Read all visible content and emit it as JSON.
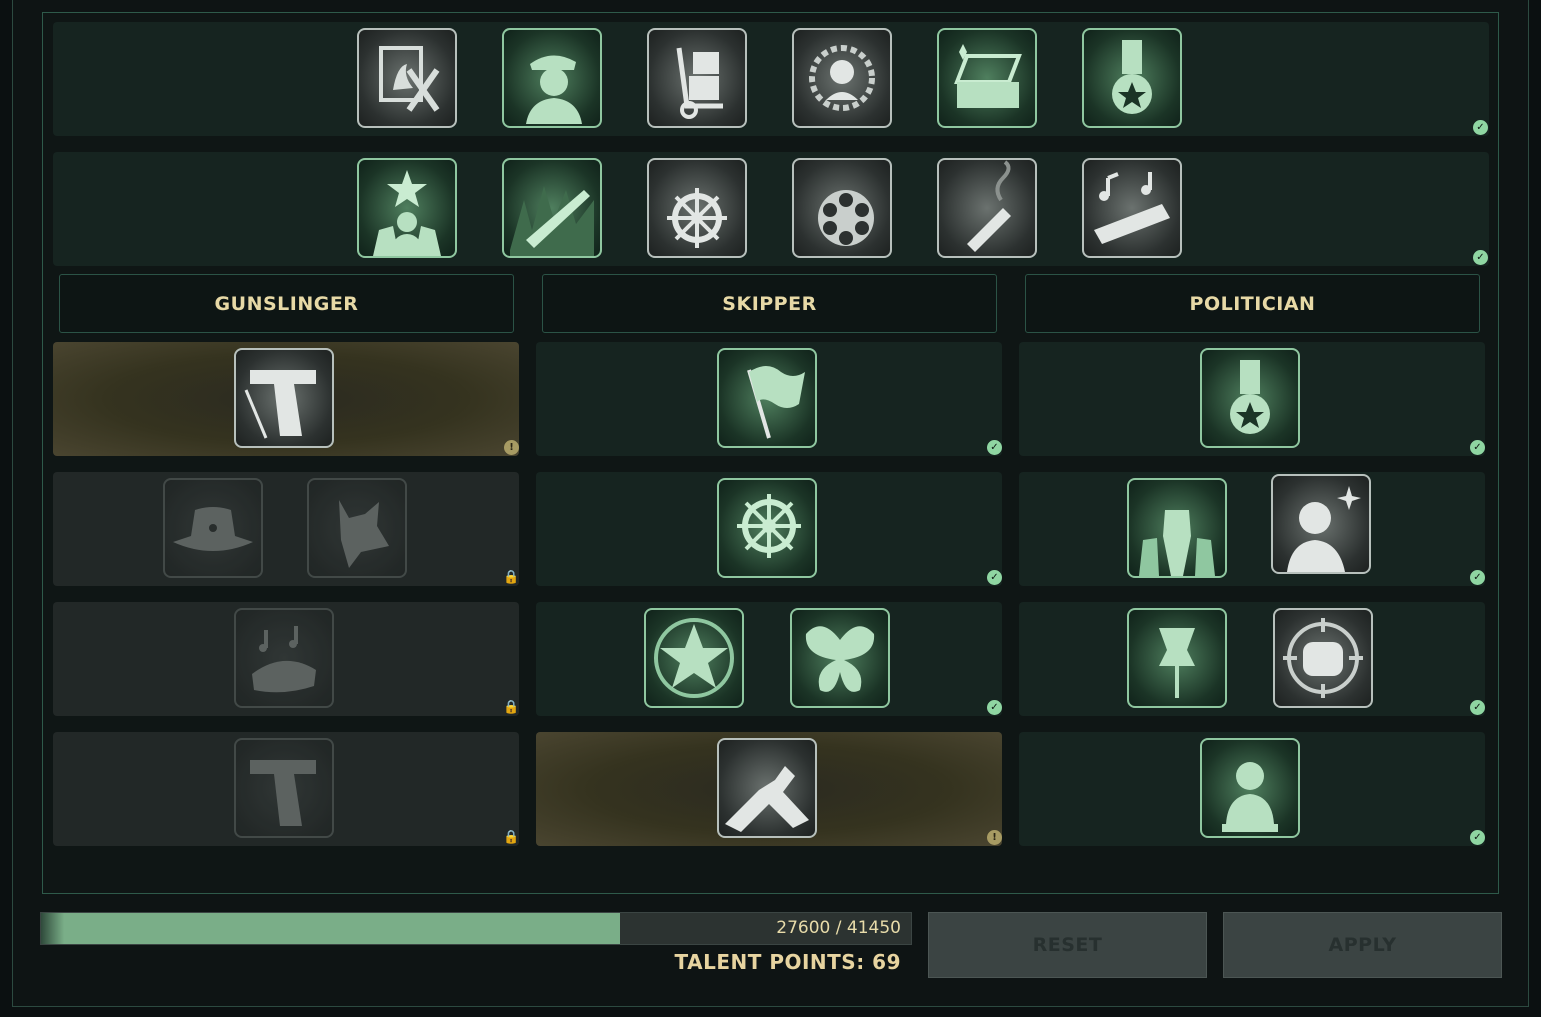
{
  "top_rows": {
    "row1": {
      "icons": [
        "crossed-portrait-icon",
        "officer-icon",
        "hand-truck-icon",
        "laurel-portrait-icon",
        "open-case-icon",
        "medal-icon"
      ]
    },
    "row2": {
      "icons": [
        "star-crowd-icon",
        "burning-rifle-icon",
        "ships-wheel-icon",
        "revolver-cylinder-icon",
        "cigar-icon",
        "harmonica-icon"
      ]
    }
  },
  "classes": [
    {
      "title": "GUNSLINGER"
    },
    {
      "title": "SKIPPER"
    },
    {
      "title": "POLITICIAN"
    }
  ],
  "progress": {
    "current": 27600,
    "max": 41450,
    "label": "27600 / 41450"
  },
  "talent_points": "TALENT POINTS: 69",
  "buttons": {
    "reset": "RESET",
    "apply": "APPLY"
  },
  "colors": {
    "accent": "#8fc7a0",
    "gold_text": "#e7d9a6",
    "check": "#8fd6a2",
    "warning": "#a79b63"
  }
}
